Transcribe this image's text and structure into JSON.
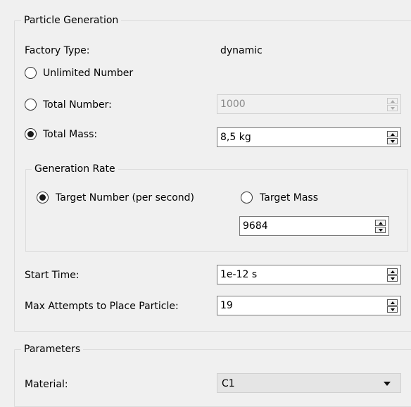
{
  "particle_generation": {
    "title": "Particle Generation",
    "factory_type_label": "Factory Type:",
    "factory_type_value": "dynamic",
    "unlimited_label": "Unlimited Number",
    "total_number_label": "Total Number:",
    "total_number_value": "1000",
    "total_number_enabled": false,
    "total_mass_label": "Total Mass:",
    "total_mass_value": "8,5 kg",
    "selected_mode": "total_mass",
    "generation_rate": {
      "title": "Generation Rate",
      "target_number_label": "Target Number (per second)",
      "target_mass_label": "Target Mass",
      "selected": "target_number",
      "value": "9684"
    },
    "start_time_label": "Start Time:",
    "start_time_value": "1e-12 s",
    "max_attempts_label": "Max Attempts to Place Particle:",
    "max_attempts_value": "19"
  },
  "parameters": {
    "title": "Parameters",
    "material_label": "Material:",
    "material_value": "C1"
  }
}
